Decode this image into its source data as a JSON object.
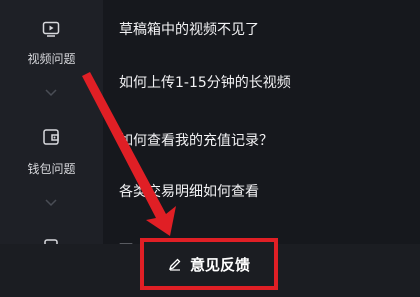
{
  "sidebar": {
    "categories": [
      {
        "label": "视频问题",
        "icon": "video-icon"
      },
      {
        "label": "钱包问题",
        "icon": "wallet-icon"
      },
      {
        "label": "",
        "icon": "document-icon"
      }
    ]
  },
  "questions": [
    "草稿箱中的视频不见了",
    "如何上传1-15分钟的长视频",
    "如何查看我的充值记录？",
    "各类交易明细如何查看"
  ],
  "feedback_button": {
    "label": "意见反馈",
    "icon": "pencil-icon"
  },
  "colors": {
    "highlight": "#e01f25",
    "background": "#16181d",
    "sidebar": "#1e2026"
  }
}
